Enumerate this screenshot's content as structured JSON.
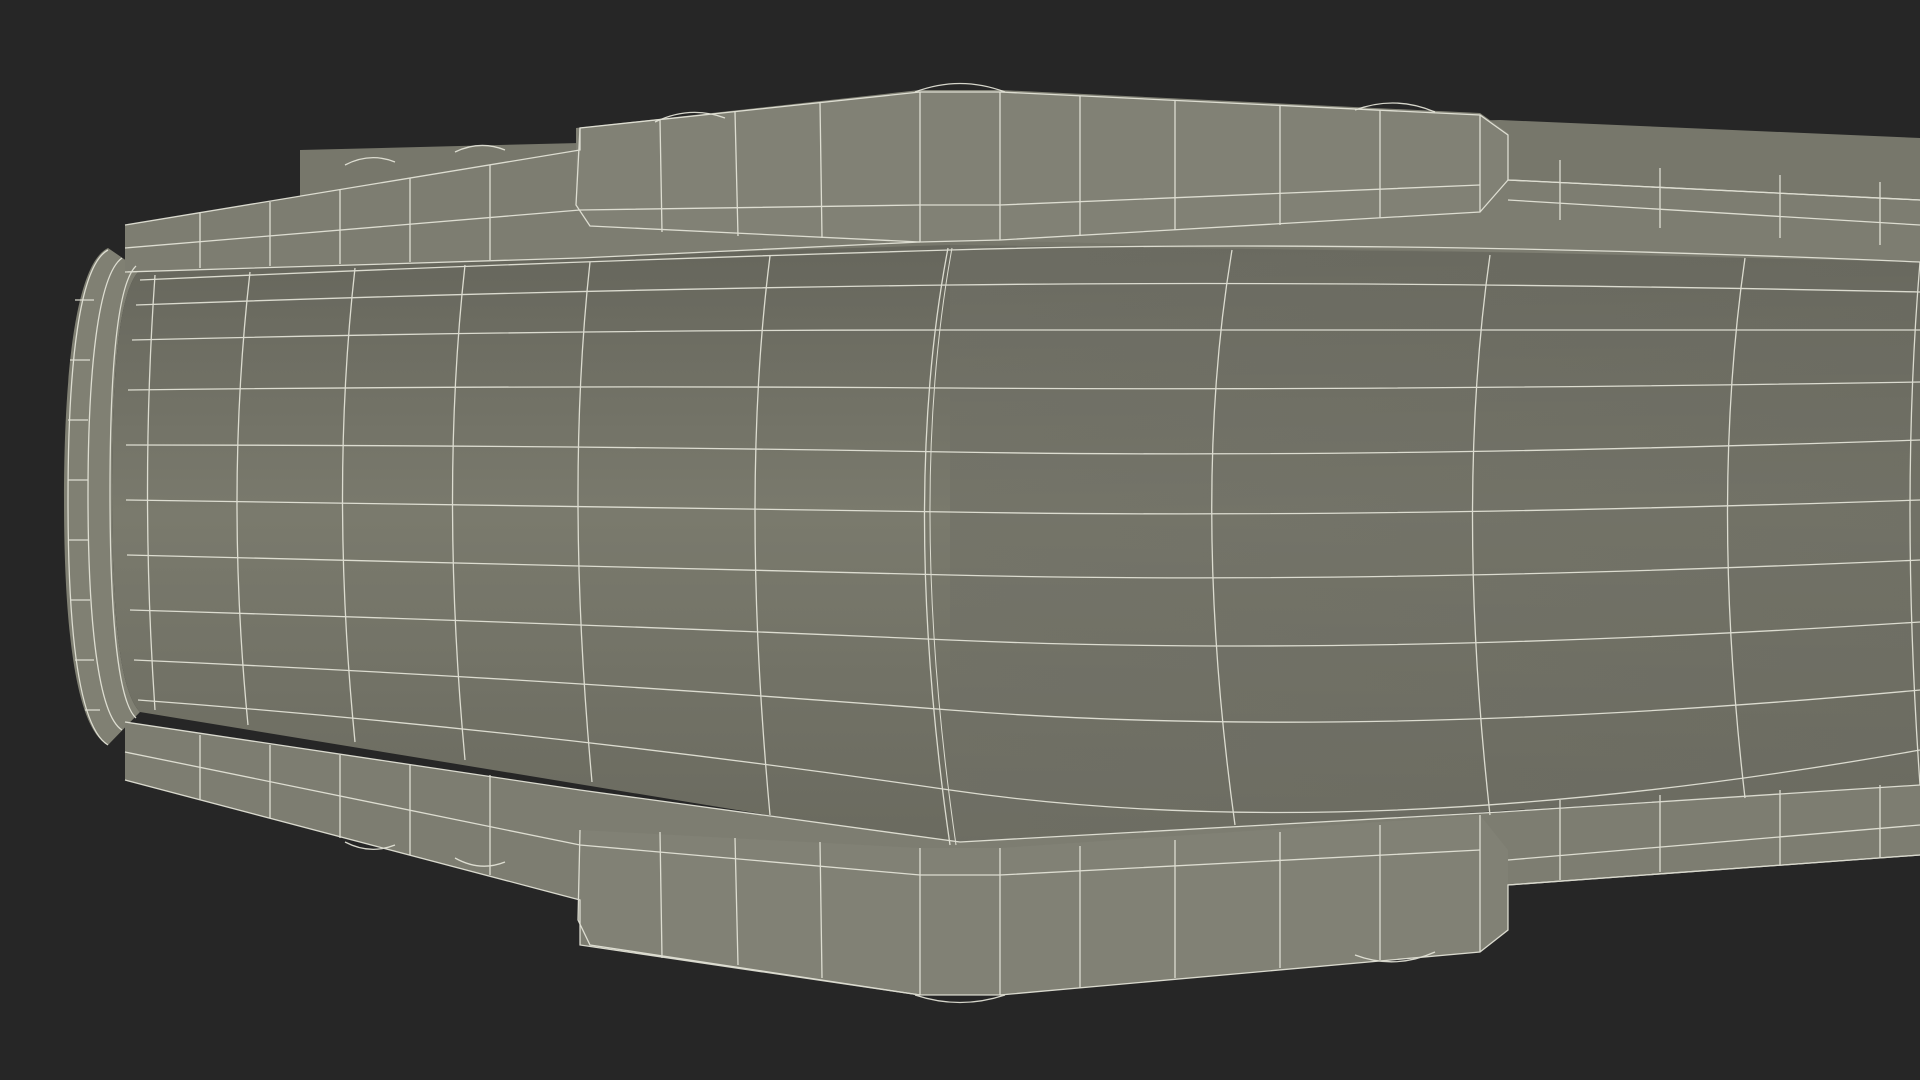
{
  "scene": {
    "subject": "book-wireframe-render",
    "background_color": "#262626",
    "surface_color": "#7b7b6e",
    "surface_dark_color": "#6b6b60",
    "wire_color": "#e8e8dc"
  }
}
